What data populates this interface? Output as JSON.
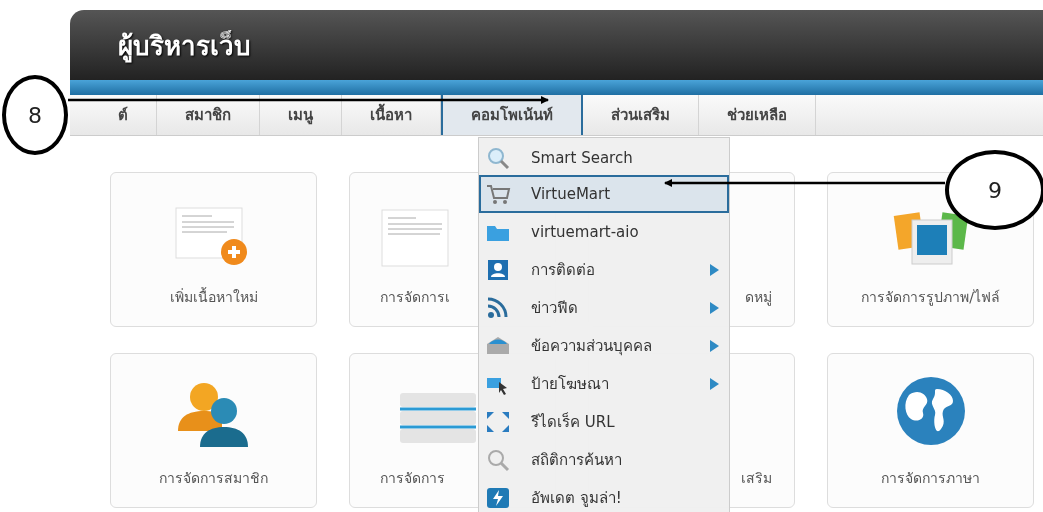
{
  "header": {
    "title": "ผู้บริหารเว็บ"
  },
  "nav": [
    {
      "label": "ต์",
      "selected": false
    },
    {
      "label": "สมาชิก",
      "selected": false
    },
    {
      "label": "เมนู",
      "selected": false
    },
    {
      "label": "เนื้อหา",
      "selected": false
    },
    {
      "label": "คอมโพเน้นท์",
      "selected": true
    },
    {
      "label": "ส่วนเสริม",
      "selected": false
    },
    {
      "label": "ช่วยเหลือ",
      "selected": false
    }
  ],
  "dropdown": {
    "items": [
      {
        "label": "Smart Search",
        "selected": false,
        "submenu": false
      },
      {
        "label": "VirtueMart",
        "selected": true,
        "submenu": false
      },
      {
        "label": "virtuemart-aio",
        "selected": false,
        "submenu": false
      },
      {
        "label": "การติดต่อ",
        "selected": false,
        "submenu": true
      },
      {
        "label": "ข่าวฟีด",
        "selected": false,
        "submenu": true
      },
      {
        "label": "ข้อความส่วนบุคคล",
        "selected": false,
        "submenu": true
      },
      {
        "label": "ป้ายโฆษณา",
        "selected": false,
        "submenu": true
      },
      {
        "label": "รีไดเร็ค URL",
        "selected": false,
        "submenu": false
      },
      {
        "label": "สถิติการค้นหา",
        "selected": false,
        "submenu": false
      },
      {
        "label": "อัพเดต จูมล่า!",
        "selected": false,
        "submenu": false
      }
    ]
  },
  "cards": [
    {
      "label": "เพิ่มเนื้อหาใหม่"
    },
    {
      "label": "การจัดการเ"
    },
    {
      "label": "ดหมู่"
    },
    {
      "label": "การจัดการรูปภาพ/ไฟล์"
    },
    {
      "label": "การจัดการสมาชิก"
    },
    {
      "label": "การจัดการ"
    },
    {
      "label": "เสริม"
    },
    {
      "label": "การจัดการภาษา"
    }
  ],
  "annotations": [
    {
      "number": "8"
    },
    {
      "number": "9"
    }
  ]
}
